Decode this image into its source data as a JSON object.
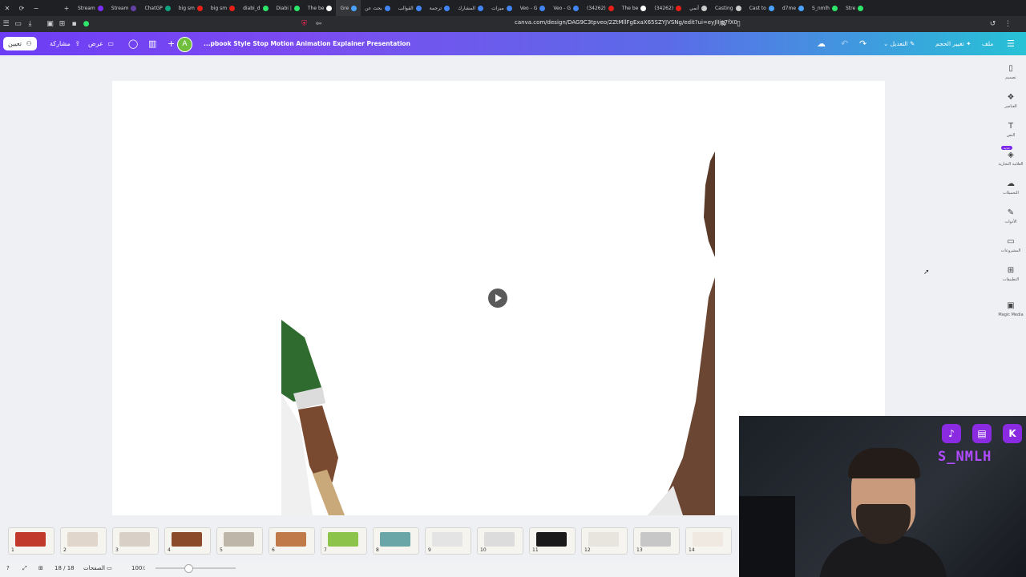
{
  "browser": {
    "tabs": [
      {
        "label": "Stream",
        "color": "#7b2ff7"
      },
      {
        "label": "Stream",
        "color": "#6441a5"
      },
      {
        "label": "ChatGP",
        "color": "#10a37f"
      },
      {
        "label": "big sm",
        "color": "#e62117"
      },
      {
        "label": "big sm",
        "color": "#e62117"
      },
      {
        "label": "diabi_d",
        "color": "#2ee66a"
      },
      {
        "label": "Diabi |",
        "color": "#2ee66a"
      },
      {
        "label": "The be",
        "color": "#ffffff"
      },
      {
        "label": "Gre",
        "color": "#4aa3ff",
        "active": true
      },
      {
        "label": "بحث عن",
        "color": "#4285f4"
      },
      {
        "label": "القوالب",
        "color": "#4285f4"
      },
      {
        "label": "ترجمة",
        "color": "#4285f4"
      },
      {
        "label": "المشارك",
        "color": "#4285f4"
      },
      {
        "label": "ميزات",
        "color": "#4285f4"
      },
      {
        "label": "Veo - G",
        "color": "#4285f4"
      },
      {
        "label": "Veo - G",
        "color": "#4285f4"
      },
      {
        "label": "(34262)",
        "color": "#e62117"
      },
      {
        "label": "The be",
        "color": "#ffffff"
      },
      {
        "label": "(34262)",
        "color": "#e62117"
      },
      {
        "label": "أنمي",
        "color": "#cccccc"
      },
      {
        "label": "Casting",
        "color": "#cccccc"
      },
      {
        "label": "Cast to",
        "color": "#4aa3ff"
      },
      {
        "label": "d7me",
        "color": "#4aa3ff"
      },
      {
        "label": "S_nmlh",
        "color": "#2ee66a"
      },
      {
        "label": "Stre",
        "color": "#2ee66a"
      }
    ],
    "url": "canva.com/design/DAG9C3tpveo/2ZtMllFgExaX65SZYJVSNg/edit?ui=eyJlIjp7fX0"
  },
  "header": {
    "assign_label": "تعيين",
    "share_label": "مشاركة",
    "present_label": "عرض",
    "avatar_letter": "A",
    "doc_title": "...pbook Style Stop Motion Animation Explainer Presentation",
    "edit_label": "التعديل",
    "resize_label": "تغيير الحجم",
    "file_label": "ملف"
  },
  "side_panel": [
    {
      "label": "تصميم",
      "icon": "layout-icon"
    },
    {
      "label": "العناصر",
      "icon": "elements-icon"
    },
    {
      "label": "النص",
      "icon": "text-icon"
    },
    {
      "label": "العلامة التجارية",
      "icon": "brand-icon",
      "badge": "جديد"
    },
    {
      "label": "التحميلات",
      "icon": "upload-icon"
    },
    {
      "label": "الأدوات",
      "icon": "draw-icon"
    },
    {
      "label": "المشروعات",
      "icon": "folder-icon"
    },
    {
      "label": "التطبيقات",
      "icon": "apps-icon"
    },
    {
      "label": "Magic Media",
      "icon": "magic-media-icon"
    }
  ],
  "thumbnails": [
    {
      "num": "1",
      "color": "#c0392b"
    },
    {
      "num": "2",
      "color": "#e0d6cc"
    },
    {
      "num": "3",
      "color": "#d8d0c6"
    },
    {
      "num": "4",
      "color": "#8b4a2a"
    },
    {
      "num": "5",
      "color": "#bfb6aa"
    },
    {
      "num": "6",
      "color": "#c07a4a"
    },
    {
      "num": "7",
      "color": "#8cc34a"
    },
    {
      "num": "8",
      "color": "#6aa6a8"
    },
    {
      "num": "9",
      "color": "#e4e4e4"
    },
    {
      "num": "10",
      "color": "#dcdcdc"
    },
    {
      "num": "11",
      "color": "#1a1a1a"
    },
    {
      "num": "12",
      "color": "#e8e4de"
    },
    {
      "num": "13",
      "color": "#c7c7c7"
    },
    {
      "num": "14",
      "color": "#efe9e1"
    }
  ],
  "footer": {
    "page_counter": "18 / 18",
    "pages_label": "الصفحات",
    "zoom": "100٪"
  },
  "webcam": {
    "handle": "S_NMLH"
  }
}
